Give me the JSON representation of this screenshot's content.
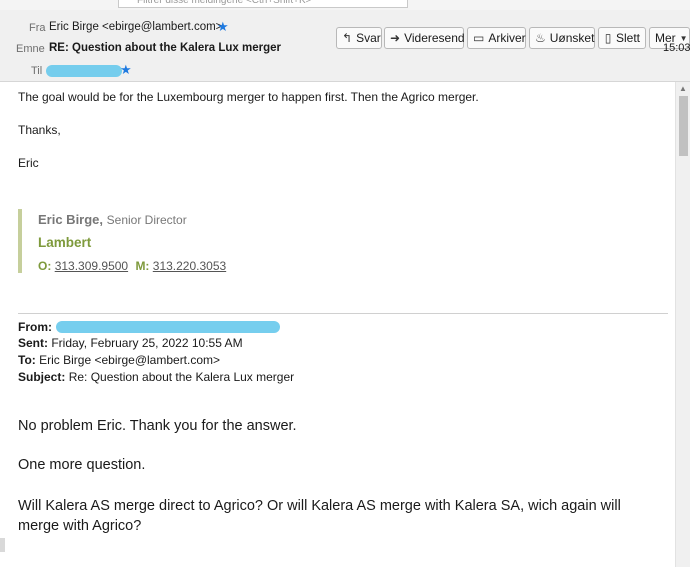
{
  "filter_bar": {
    "placeholder": "Filtrer disse meldingene <Ctrl+Shift+K>"
  },
  "header": {
    "from_label": "Fra",
    "from_value": "Eric Birge <ebirge@lambert.com>",
    "subject_label": "Emne",
    "subject_value": "RE: Question about the Kalera Lux merger",
    "to_label": "Til",
    "time": "15:03"
  },
  "toolbar": {
    "reply": "Svar",
    "forward": "Videresend",
    "archive": "Arkiver",
    "junk": "Uønsket",
    "delete": "Slett",
    "more": "Mer"
  },
  "body": {
    "line1": "The goal would be for the Luxembourg merger to happen first. Then the Agrico merger.",
    "thanks": "Thanks,",
    "name": "Eric"
  },
  "signature": {
    "name": "Eric Birge,",
    "title": "Senior Director",
    "company": "Lambert",
    "office_label": "O:",
    "office_phone": "313.309.9500",
    "mobile_label": "M:",
    "mobile_phone": "313.220.3053"
  },
  "quoted": {
    "from_label": "From:",
    "sent_label": "Sent:",
    "sent_value": "Friday, February 25, 2022 10:55 AM",
    "to_label": "To:",
    "to_value": "Eric Birge <ebirge@lambert.com>",
    "subject_label": "Subject:",
    "subject_value": "Re: Question about the Kalera Lux merger"
  },
  "message": {
    "line1": "No problem Eric. Thank you for the answer.",
    "line2": "One more question.",
    "line3": "Will Kalera AS merge direct to Agrico? Or will Kalera AS merge with Kalera SA, wich again will merge with Agrico?"
  }
}
